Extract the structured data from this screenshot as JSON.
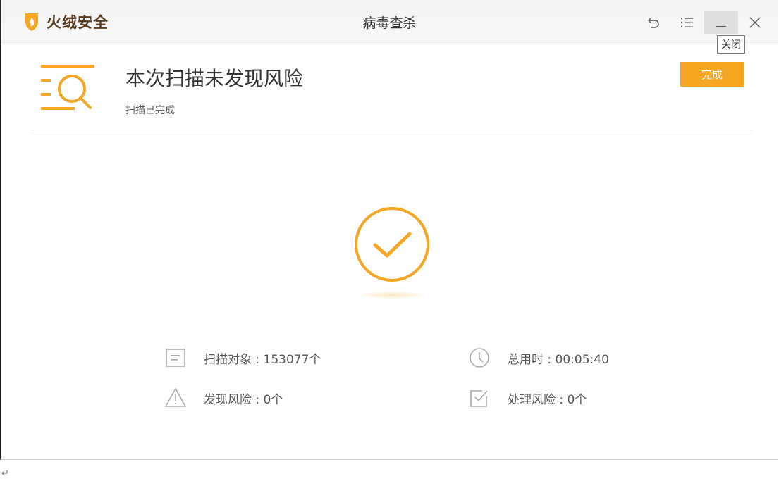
{
  "app": {
    "brand_name": "火绒安全",
    "window_title": "病毒查杀",
    "accent_color": "#f5a623"
  },
  "window_controls": {
    "back_icon": "back-arrow-icon",
    "menu_icon": "menu-list-icon",
    "minimize_icon": "minimize-icon",
    "close_icon": "close-icon",
    "tooltip": "关闭"
  },
  "result": {
    "title": "本次扫描未发现风险",
    "subtitle": "扫描已完成",
    "done_label": "完成",
    "status_icon": "check-circle-icon"
  },
  "stats": {
    "objects": "扫描对象 : 153077个",
    "time": "总用时 : 00:05:40",
    "risks_found": "发现风险 : 0个",
    "risks_handled": "处理风险 : 0个"
  },
  "footer": {
    "return_glyph": "↵"
  }
}
